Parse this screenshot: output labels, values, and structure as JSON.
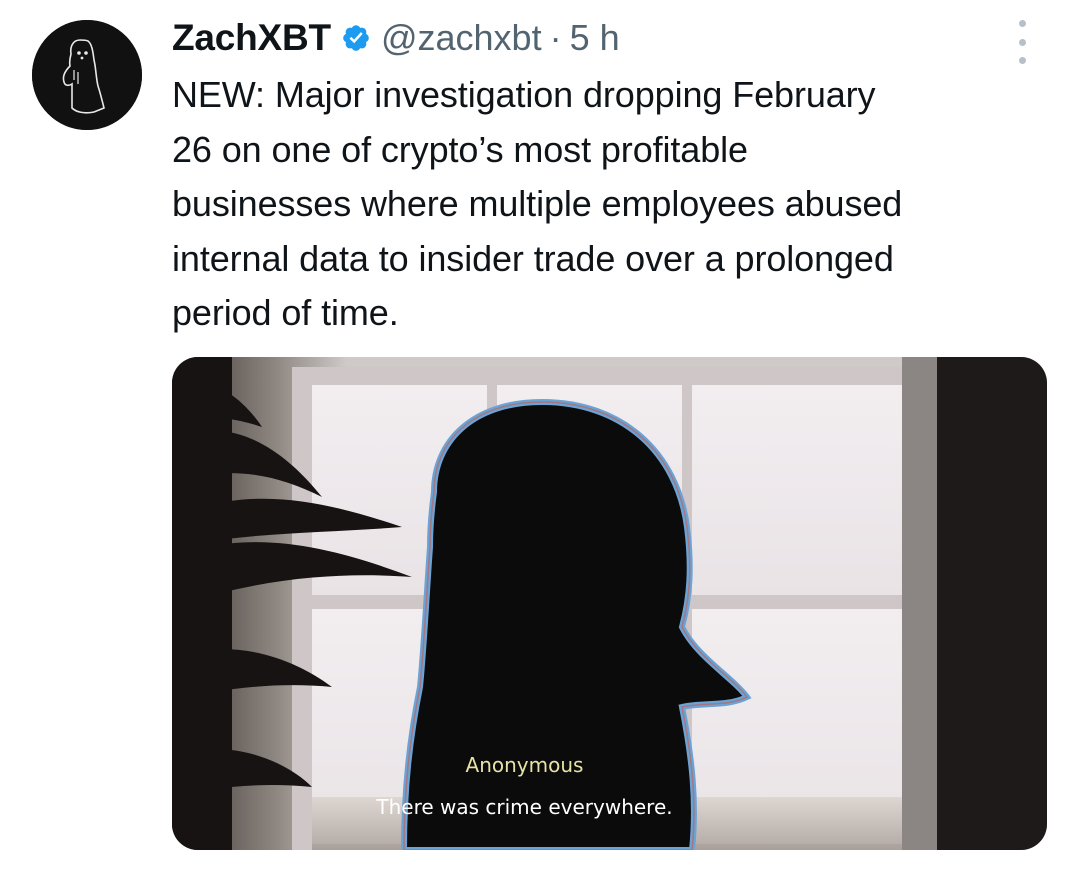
{
  "tweet": {
    "author": {
      "display_name": "ZachXBT",
      "handle": "@zachxbt",
      "verified": true,
      "avatar_icon": "ghost-avatar-icon"
    },
    "separator": "·",
    "time": "5 h",
    "text": "NEW: Major investigation dropping February\n26 on one of crypto’s most profitable\nbusinesses where multiple employees abused\ninternal data to insider trade over a prolonged\nperiod of time.",
    "media": {
      "caption_speaker": "Anonymous",
      "caption_line": "There was crime everywhere."
    },
    "more_icon": "more-vertical-icon"
  },
  "colors": {
    "text_primary": "#0f1419",
    "text_secondary": "#536471",
    "verified_blue": "#1d9bf0",
    "caption_speaker": "#e6e3a4"
  }
}
